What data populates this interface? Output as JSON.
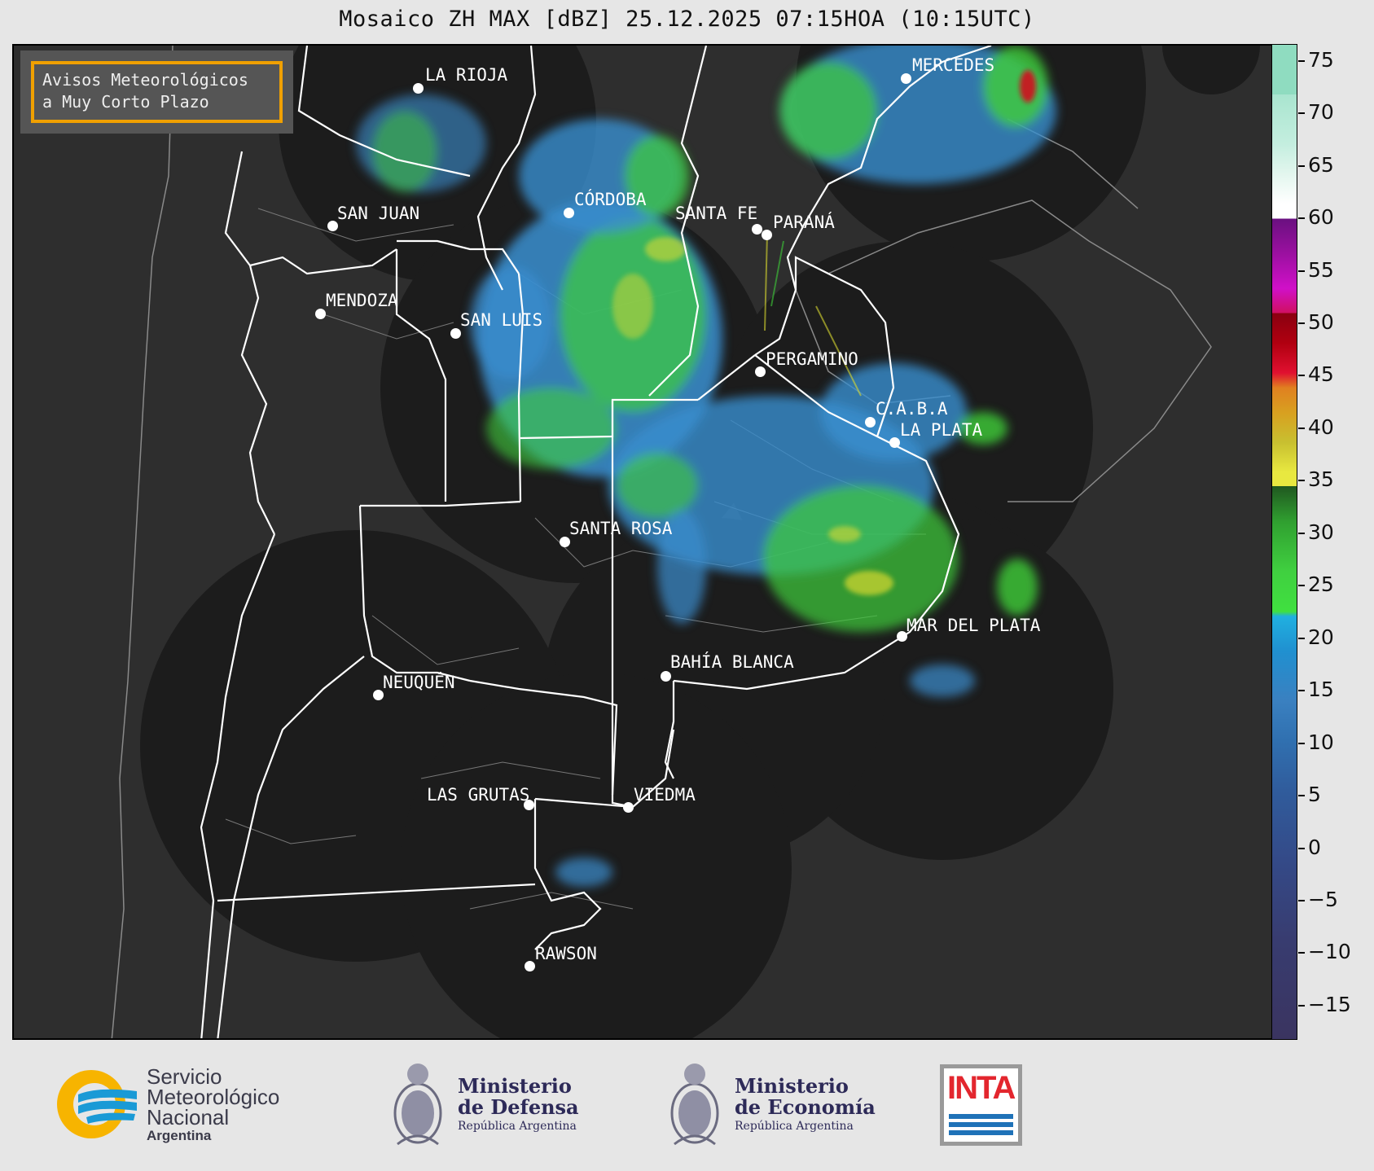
{
  "title": "Mosaico ZH MAX [dBZ] 25.12.2025 07:15HOA (10:15UTC)",
  "notice": {
    "line1": "Avisos Meteorológicos",
    "line2": "a Muy Corto Plazo"
  },
  "cities": [
    {
      "name": "LA RIOJA"
    },
    {
      "name": "MERCEDES"
    },
    {
      "name": "CÓRDOBA"
    },
    {
      "name": "SAN JUAN"
    },
    {
      "name": "SANTA FE"
    },
    {
      "name": "PARANÁ"
    },
    {
      "name": "MENDOZA"
    },
    {
      "name": "SAN LUIS"
    },
    {
      "name": "PERGAMINO"
    },
    {
      "name": "C.A.B.A"
    },
    {
      "name": "LA PLATA"
    },
    {
      "name": "SANTA ROSA"
    },
    {
      "name": "MAR DEL PLATA"
    },
    {
      "name": "BAHÍA BLANCA"
    },
    {
      "name": "NEUQUÉN"
    },
    {
      "name": "LAS GRUTAS"
    },
    {
      "name": "VIEDMA"
    },
    {
      "name": "RAWSON"
    }
  ],
  "colorbar": {
    "unit": "dBZ",
    "min": -18,
    "max": 77,
    "ticks": [
      "75",
      "70",
      "65",
      "60",
      "55",
      "50",
      "45",
      "40",
      "35",
      "30",
      "25",
      "20",
      "15",
      "10",
      "5",
      "0",
      "−5",
      "−10",
      "−15"
    ]
  },
  "footer": {
    "smn": {
      "line1": "Servicio",
      "line2": "Meteorológico",
      "line3": "Nacional",
      "line4": "Argentina"
    },
    "defensa": {
      "line1": "Ministerio",
      "line2": "de Defensa",
      "line3": "República Argentina"
    },
    "economia": {
      "line1": "Ministerio",
      "line2": "de Economía",
      "line3": "República Argentina"
    },
    "inta": {
      "label": "INTA"
    }
  },
  "colors": {
    "map_bg": "#2e2e2e",
    "radar_coverage": "#1c1c1c",
    "notice_border": "#f0a000",
    "echo_blue": "#3a8fd0",
    "echo_green": "#3fce3a",
    "echo_yellow": "#d8d830",
    "echo_red": "#d01020"
  }
}
